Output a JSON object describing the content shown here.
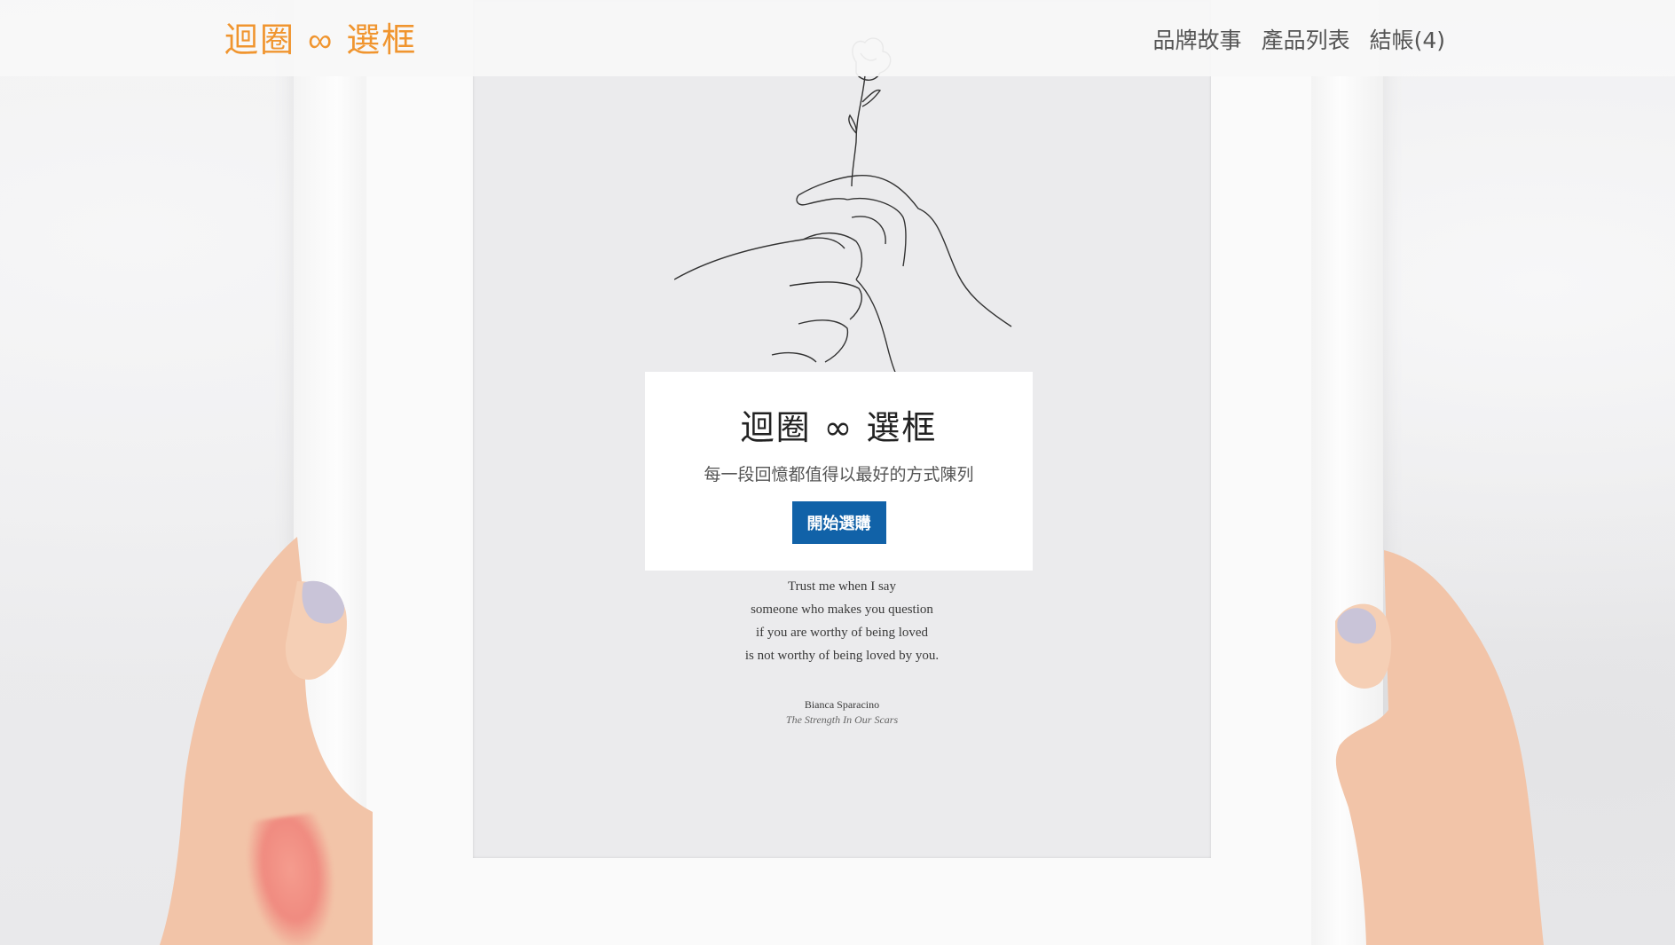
{
  "header": {
    "brand": "迴圈 ∞ 選框",
    "nav": [
      {
        "label": "品牌故事"
      },
      {
        "label": "產品列表"
      },
      {
        "label": "結帳(4)"
      }
    ]
  },
  "hero": {
    "title": "迴圈 ∞ 選框",
    "subtitle": "每一段回憶都值得以最好的方式陳列",
    "cta": "開始選購"
  },
  "poster": {
    "lines": [
      "Trust me when I say",
      "someone who makes you question",
      "if you are worthy of being loved",
      "is not worthy of being loved by you."
    ],
    "author": "Bianca Sparacino",
    "book": "The Strength In Our Scars"
  },
  "colors": {
    "brand": "#f0952f",
    "button": "#1162a8"
  }
}
